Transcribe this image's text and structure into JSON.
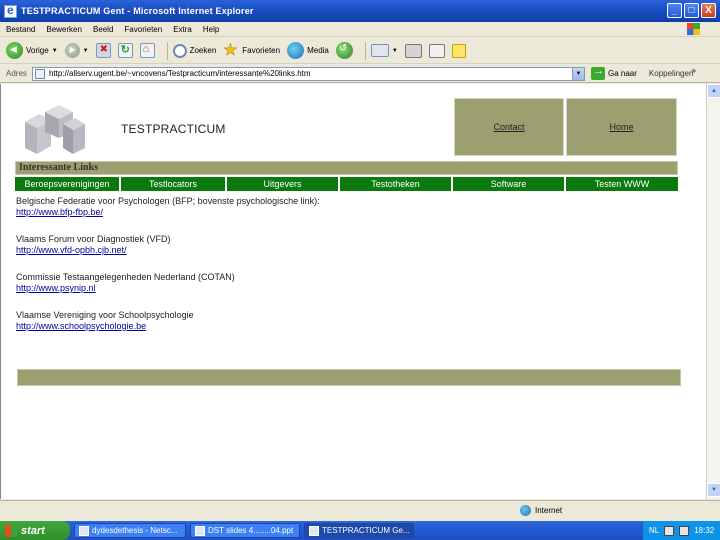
{
  "window": {
    "title": "TESTPRACTICUM Gent - Microsoft Internet Explorer",
    "buttons": {
      "minimize": "_",
      "maximize": "□",
      "close": "X"
    }
  },
  "menu": [
    "Bestand",
    "Bewerken",
    "Beeld",
    "Favorieten",
    "Extra",
    "Help"
  ],
  "toolbar": {
    "back": "Vorige",
    "search": "Zoeken",
    "favorites": "Favorieten",
    "media": "Media"
  },
  "address": {
    "label": "Adres",
    "url": "http://allserv.ugent.be/~vncovens/Testpracticum/interessante%20links.htm",
    "go": "Ga naar",
    "links": "Koppelingen",
    "more": "»"
  },
  "page": {
    "brand": "TESTPRACTICUM",
    "nav": [
      {
        "label": "Contact"
      },
      {
        "label": "Home"
      }
    ],
    "section_title": "Interessante Links",
    "tabs": [
      "Beroepsverenigingen",
      "Testlocators",
      "Uitgevers",
      "Testotheken",
      "Software",
      "Testen WWW"
    ],
    "links": [
      {
        "desc": "Belgische Federatie voor Psychologen (BFP; bovenste psychologische link):",
        "url": "http://www.bfp-fbp.be/"
      },
      {
        "desc": "Vlaams Forum voor Diagnostiek (VFD)",
        "url": "http://www.vfd-opbh.cjb.net/"
      },
      {
        "desc": "Commissie Testaangelegenheden Nederland (COTAN)",
        "url": "http://www.psynip.nl"
      },
      {
        "desc": "Vlaamse Vereniging voor Schoolpsychologie",
        "url": "http://www.schoolpsychologie.be"
      }
    ]
  },
  "status": {
    "zone": "Internet"
  },
  "taskbar": {
    "start": "start",
    "tasks": [
      "dydesdethesis - Netsc...",
      "DST slides 4........04.ppt",
      "TESTPRACTICUM Ge..."
    ],
    "lang": "NL",
    "time": "18:32"
  },
  "colors": {
    "olive": "#9c9f6f",
    "tab_green": "#0a7a0e",
    "link_blue": "#0000a0",
    "titlebar_blue": "#1a4fc3"
  }
}
